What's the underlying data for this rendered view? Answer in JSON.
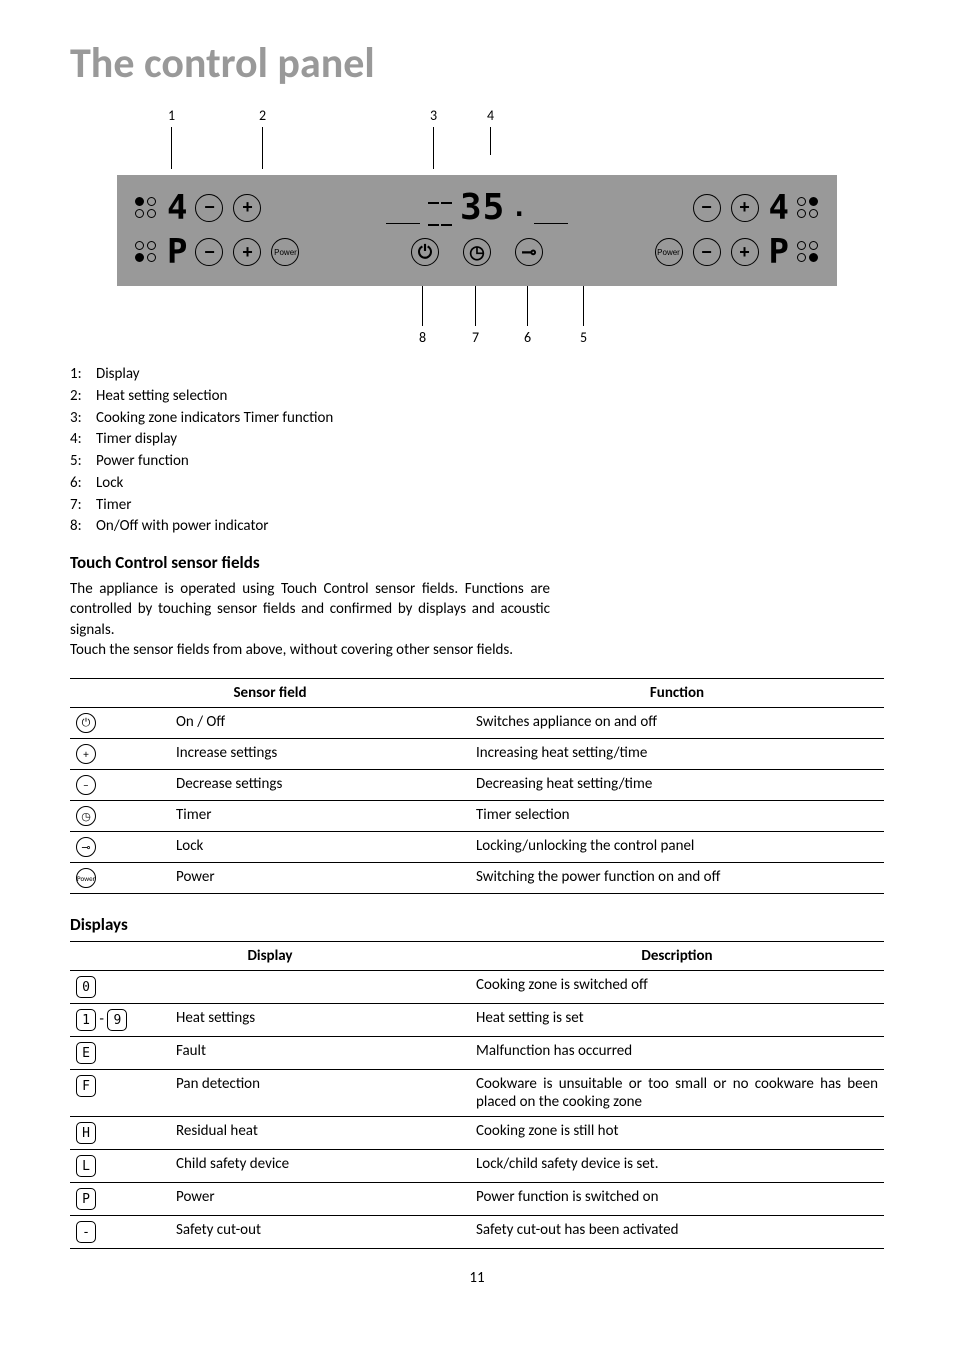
{
  "title": "The control panel",
  "panel": {
    "digit_left_top": "4",
    "digit_left_bottom": "P",
    "timer_zone_value": "35",
    "digit_right_top": "4",
    "digit_right_bottom": "P",
    "power_label": "Power",
    "callout_1": "1",
    "callout_2": "2",
    "callout_3": "3",
    "callout_4": "4",
    "callout_5": "5",
    "callout_6": "6",
    "callout_7": "7",
    "callout_8": "8"
  },
  "legend": [
    {
      "n": "1:",
      "t": "Display"
    },
    {
      "n": "2:",
      "t": "Heat setting selection"
    },
    {
      "n": "3:",
      "t": "Cooking zone indicators Timer function"
    },
    {
      "n": "4:",
      "t": "Timer display"
    },
    {
      "n": "5:",
      "t": "Power function"
    },
    {
      "n": "6:",
      "t": "Lock"
    },
    {
      "n": "7:",
      "t": "Timer"
    },
    {
      "n": "8:",
      "t": "On/Off with power indicator"
    }
  ],
  "touch_heading": "Touch Control sensor fields",
  "touch_para1": "The appliance is operated using Touch Control sensor fields. Functions are controlled by touching sensor fields and confirmed by displays and acoustic signals.",
  "touch_para2": "Touch the sensor fields from above, without covering other sensor fields.",
  "sensor_table": {
    "head_field": "Sensor field",
    "head_func": "Function",
    "rows": [
      {
        "icon": "power-circle",
        "label": "On / Off",
        "func": "Switches appliance on and off"
      },
      {
        "icon": "plus-circle",
        "label": "Increase settings",
        "func": "Increasing heat setting/time"
      },
      {
        "icon": "minus-circle",
        "label": "Decrease settings",
        "func": "Decreasing heat setting/time"
      },
      {
        "icon": "clock-circle",
        "label": "Timer",
        "func": "Timer selection"
      },
      {
        "icon": "key-circle",
        "label": "Lock",
        "func": "Locking/unlocking the control panel"
      },
      {
        "icon": "power-text-circle",
        "label": "Power",
        "func": "Switching the power function on and off"
      }
    ]
  },
  "displays_heading": "Displays",
  "display_table": {
    "head_display": "Display",
    "head_desc": "Description",
    "rows": [
      {
        "sym": "0",
        "label": "",
        "desc": "Cooking zone is switched off"
      },
      {
        "sym": "1-9",
        "label": "Heat settings",
        "desc": "Heat setting is set"
      },
      {
        "sym": "E",
        "label": "Fault",
        "desc": "Malfunction has occurred"
      },
      {
        "sym": "F",
        "label": "Pan detection",
        "desc": "Cookware is unsuitable or too small or no cookware has been placed on the cooking zone"
      },
      {
        "sym": "H",
        "label": "Residual heat",
        "desc": "Cooking zone is still hot"
      },
      {
        "sym": "L",
        "label": "Child safety device",
        "desc": "Lock/child safety device is set."
      },
      {
        "sym": "P",
        "label": "Power",
        "desc": "Power function is switched on"
      },
      {
        "sym": "-",
        "label": "Safety cut-out",
        "desc": "Safety cut-out has been activated"
      }
    ]
  },
  "page_number": "11"
}
